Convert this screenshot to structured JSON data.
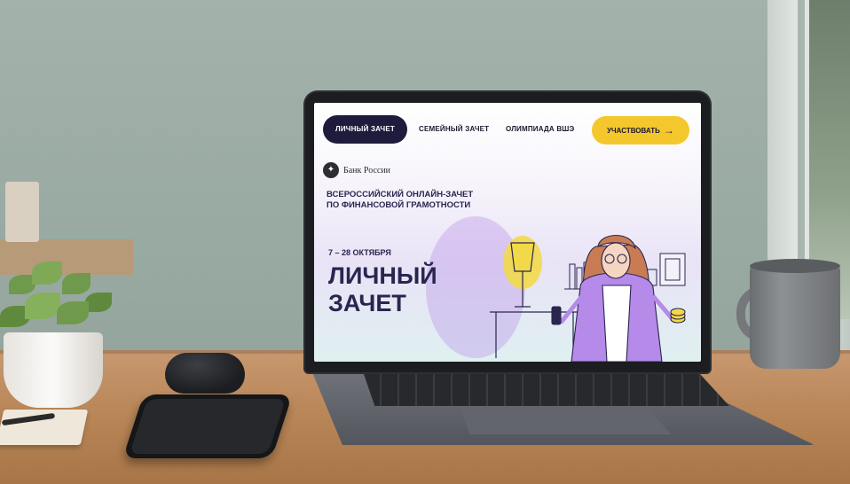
{
  "nav": {
    "tabs": [
      {
        "label": "ЛИЧНЫЙ ЗАЧЕТ",
        "active": true
      },
      {
        "label": "СЕМЕЙНЫЙ ЗАЧЕТ",
        "active": false
      },
      {
        "label": "ОЛИМПИАДА ВШЭ",
        "active": false
      }
    ],
    "cta_label": "УЧАСТВОВАТЬ",
    "cta_arrow": "→"
  },
  "brand": {
    "name": "Банк России",
    "icon": "eagle-emblem-icon"
  },
  "hero": {
    "subtitle_line1": "ВСЕРОССИЙСКИЙ ОНЛАЙН-ЗАЧЕТ",
    "subtitle_line2": "ПО ФИНАНСОВОЙ ГРАМОТНОСТИ",
    "dates": "7 – 28 ОКТЯБРЯ",
    "title_line1": "ЛИЧНЫЙ",
    "title_line2": "ЗАЧЕТ"
  },
  "colors": {
    "nav_active_bg": "#1e1b3c",
    "cta_bg": "#f4c72d",
    "headline": "#2a2550",
    "accent_purple": "#b58ae8",
    "lamp_yellow": "#f2d94a",
    "teal_tint": "#c9ece9"
  },
  "scene": {
    "objects": [
      "plant-icon",
      "earbuds-case-icon",
      "smartphone-icon",
      "laptop-icon",
      "mug-icon",
      "notebook-icon"
    ]
  }
}
